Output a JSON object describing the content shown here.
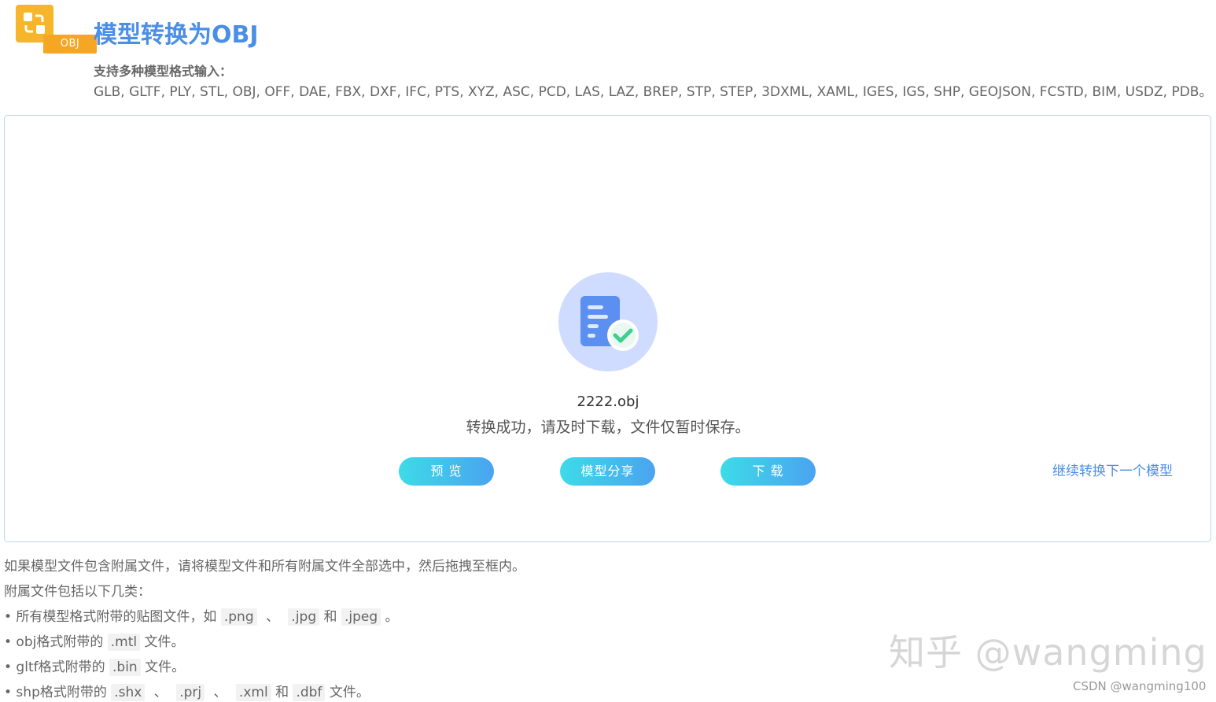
{
  "header": {
    "app_icon_tag": "OBJ",
    "title": "模型转换为OBJ",
    "support_label": "支持多种模型格式输入：",
    "formats": "GLB, GLTF, PLY, STL, OBJ, OFF, DAE, FBX, DXF, IFC, PTS, XYZ, ASC, PCD, LAS, LAZ, BREP, STP, STEP, 3DXML, XAML, IGES, IGS, SHP, GEOJSON, FCSTD, BIM, USDZ, PDB。"
  },
  "result": {
    "filename": "2222.obj",
    "message": "转换成功，请及时下载，文件仅暂时保存。",
    "buttons": {
      "preview": "预  览",
      "share": "模型分享",
      "download": "下  载"
    },
    "continue_link": "继续转换下一个模型"
  },
  "colors": {
    "title": "#4a8ee6",
    "button_gradient_start": "#3ddbe8",
    "button_gradient_end": "#4aa3f0",
    "icon_orange": "#f7b52c",
    "success_green": "#3ecf8e"
  },
  "notes": {
    "line1": "如果模型文件包含附属文件，请将模型文件和所有附属文件全部选中，然后拖拽至框内。",
    "line2": "附属文件包括以下几类：",
    "item1": {
      "prefix": "• 所有模型格式附带的贴图文件，如",
      "code1": ".png",
      "sep1": "、",
      "code2": ".jpg",
      "and": "和",
      "code3": ".jpeg",
      "suffix": "。"
    },
    "item2": {
      "prefix": "• obj格式附带的",
      "code1": ".mtl",
      "suffix": "文件。"
    },
    "item3": {
      "prefix": "• gltf格式附带的",
      "code1": ".bin",
      "suffix": "文件。"
    },
    "item4": {
      "prefix": "• shp格式附带的",
      "code1": ".shx",
      "sep1": "、",
      "code2": ".prj",
      "sep2": "、",
      "code3": ".xml",
      "and": "和",
      "code4": ".dbf",
      "suffix": "文件。"
    }
  },
  "watermarks": {
    "zhihu": "知乎 @wangming",
    "csdn": "CSDN @wangming100"
  }
}
